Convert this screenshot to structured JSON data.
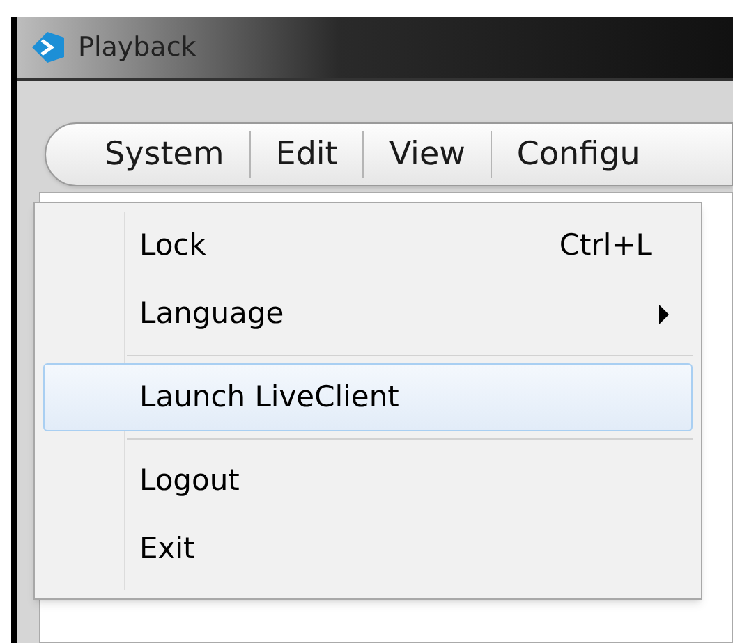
{
  "window": {
    "title": "Playback"
  },
  "menu_bar": [
    {
      "label": "System"
    },
    {
      "label": "Edit"
    },
    {
      "label": "View"
    },
    {
      "label": "Configu"
    }
  ],
  "dropdown": [
    {
      "kind": "item",
      "label": "Lock",
      "shortcut": "Ctrl+L",
      "has_submenu": false,
      "highlighted": false
    },
    {
      "kind": "item",
      "label": "Language",
      "has_submenu": true,
      "highlighted": false
    },
    {
      "kind": "separator"
    },
    {
      "kind": "item",
      "label": "Launch LiveClient",
      "has_submenu": false,
      "highlighted": true
    },
    {
      "kind": "separator"
    },
    {
      "kind": "item",
      "label": "Logout",
      "has_submenu": false,
      "highlighted": false
    },
    {
      "kind": "item",
      "label": "Exit",
      "has_submenu": false,
      "highlighted": false
    }
  ]
}
